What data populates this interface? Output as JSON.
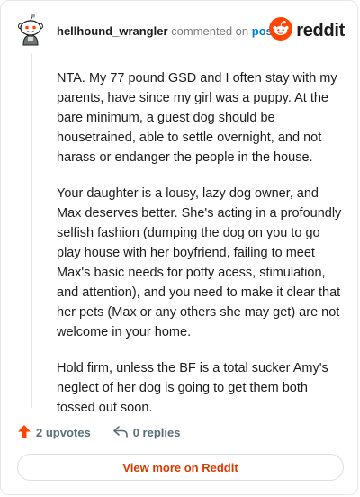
{
  "comment": {
    "username": "hellhound_wrangler",
    "commented_text": "commented on",
    "post_link": "post",
    "paragraphs": [
      "NTA. My 77 pound GSD and I often stay with my parents, have since my girl was a puppy. At the bare minimum, a guest dog should be housetrained, able to settle overnight, and not harass or endanger the people in the house.",
      "Your daughter is a lousy, lazy dog owner, and Max deserves better. She's acting in a profoundly selfish fashion (dumping the dog on you to go play house with her boyfriend, failing to meet Max's basic needs for potty acess, stimulation, and attention), and you need to make it clear that her pets (Max or any others she may get) are not welcome in your home.",
      "Hold firm, unless the BF is a total sucker Amy's neglect of her dog is going to get them both tossed out soon."
    ],
    "upvotes": "2 upvotes",
    "replies": "0 replies",
    "view_more": "View more on Reddit"
  },
  "brand": {
    "name": "reddit",
    "color": "#ff4500"
  },
  "icons": {
    "avatar": "snoo-avatar-icon",
    "logo": "reddit-logo-icon",
    "upvote": "upvote-arrow-icon",
    "reply": "reply-arrow-icon"
  },
  "colors": {
    "link": "#0079d3",
    "upvote": "#ff4500",
    "view_more_text": "#d93a00"
  }
}
